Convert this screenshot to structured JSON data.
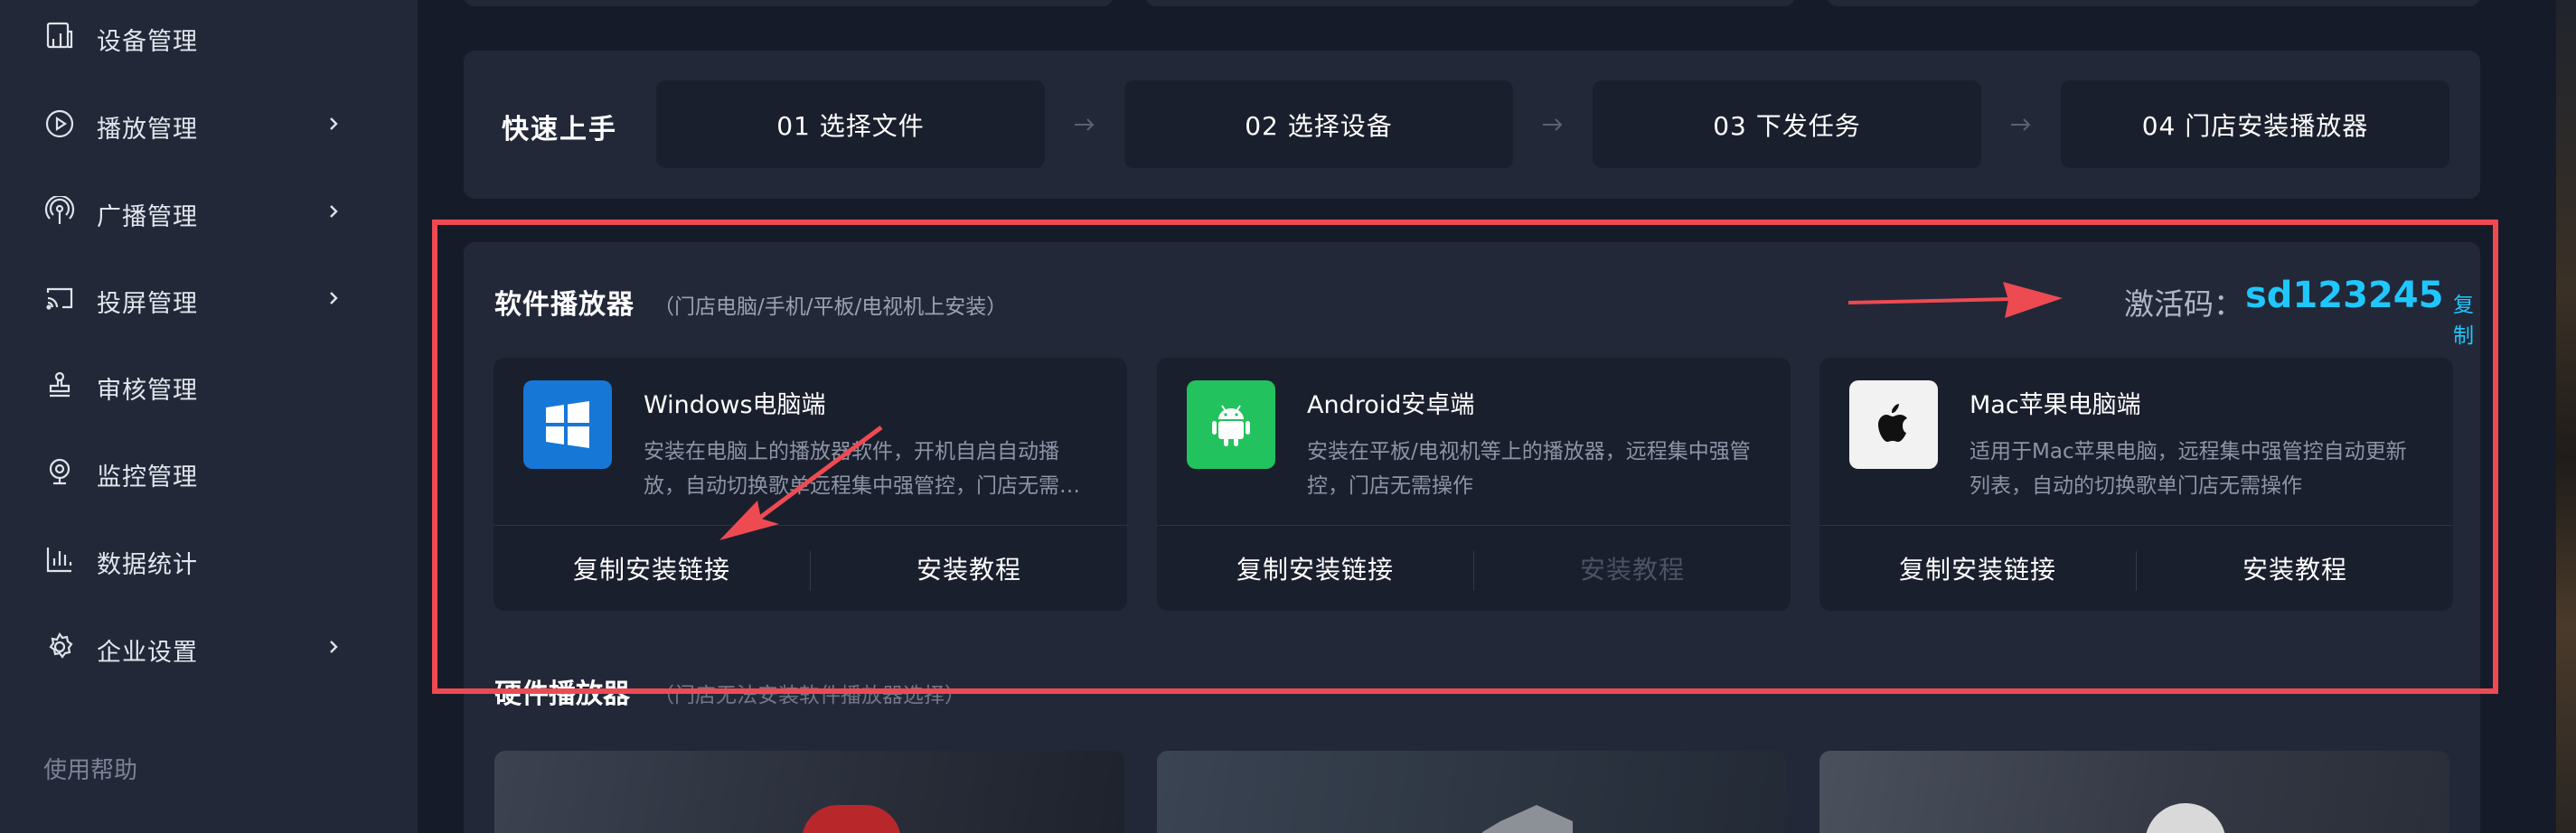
{
  "sidebar": {
    "items": [
      {
        "label": "设备管理",
        "icon": "device-icon",
        "has_chevron": false
      },
      {
        "label": "播放管理",
        "icon": "play-icon",
        "has_chevron": true
      },
      {
        "label": "广播管理",
        "icon": "broadcast-icon",
        "has_chevron": true
      },
      {
        "label": "投屏管理",
        "icon": "cast-icon",
        "has_chevron": true
      },
      {
        "label": "审核管理",
        "icon": "stamp-icon",
        "has_chevron": false
      },
      {
        "label": "监控管理",
        "icon": "camera-icon",
        "has_chevron": false
      },
      {
        "label": "数据统计",
        "icon": "bar-chart-icon",
        "has_chevron": false
      },
      {
        "label": "企业设置",
        "icon": "gear-icon",
        "has_chevron": true
      }
    ],
    "help_label": "使用帮助"
  },
  "quickstart": {
    "title": "快速上手",
    "steps": [
      "01  选择文件",
      "02  选择设备",
      "03  下发任务",
      "04  门店安装播放器"
    ],
    "arrow_icon": "arrow-right-icon"
  },
  "software": {
    "title": "软件播放器",
    "subtitle": "（门店电脑/手机/平板/电视机上安装）",
    "activation_label": "激活码：",
    "activation_code": "sd123245",
    "copy_label": "复制",
    "cards": [
      {
        "title": "Windows电脑端",
        "icon": "windows-icon",
        "logo_color": "#1677d6",
        "desc": "安装在电脑上的播放器软件，开机自启自动播放，自动切换歌单远程集中强管控，门店无需…",
        "copy_btn": "复制安装链接",
        "tutorial_btn": "安装教程",
        "tutorial_enabled": true
      },
      {
        "title": "Android安卓端",
        "icon": "android-icon",
        "logo_color": "#22c25f",
        "desc": "安装在平板/电视机等上的播放器，远程集中强管控，门店无需操作",
        "copy_btn": "复制安装链接",
        "tutorial_btn": "安装教程",
        "tutorial_enabled": false
      },
      {
        "title": "Mac苹果电脑端",
        "icon": "apple-icon",
        "logo_color": "#f2f2f2",
        "desc": "适用于Mac苹果电脑，远程集中强管控自动更新列表，自动的切换歌单门店无需操作",
        "copy_btn": "复制安装链接",
        "tutorial_btn": "安装教程",
        "tutorial_enabled": true
      }
    ]
  },
  "hardware": {
    "title": "硬件播放器",
    "subtitle": "（门店无法安装软件播放器选择）"
  },
  "colors": {
    "accent": "#1fc7ff",
    "annotation": "#ee4a52",
    "sidebar_bg": "#222838",
    "page_bg": "#161b29"
  }
}
